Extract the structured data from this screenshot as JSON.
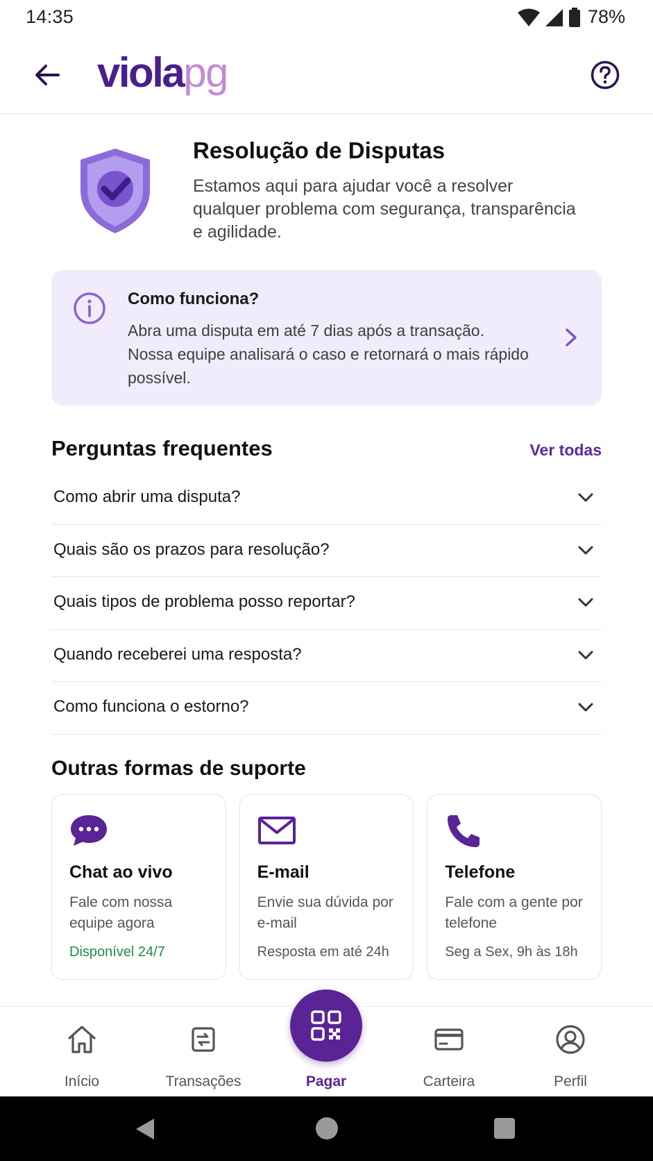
{
  "status_bar": {
    "time": "14:35",
    "battery": "78%"
  },
  "header": {
    "logo_part1": "viola",
    "logo_part2": "pg"
  },
  "hero": {
    "title": "Resolução de Disputas",
    "description": "Estamos aqui para ajudar você a resolver qualquer problema com segurança, transparência e agilidade."
  },
  "info_card": {
    "title": "Como funciona?",
    "text": "Abra uma disputa em até 7 dias após a transação. Nossa equipe analisará o caso e retornará o mais rápido possível."
  },
  "faq": {
    "title": "Perguntas frequentes",
    "see_all": "Ver todas",
    "items": [
      {
        "question": "Como abrir uma disputa?"
      },
      {
        "question": "Quais são os prazos para resolução?"
      },
      {
        "question": "Quais tipos de problema posso reportar?"
      },
      {
        "question": "Quando receberei uma resposta?"
      },
      {
        "question": "Como funciona o estorno?"
      }
    ]
  },
  "support": {
    "title": "Outras formas de suporte",
    "cards": [
      {
        "icon": "chat-bubble-icon",
        "title": "Chat ao vivo",
        "description": "Fale com nossa equipe agora",
        "footer": "Disponível 24/7"
      },
      {
        "icon": "envelope-icon",
        "title": "E-mail",
        "description": "Envie sua dúvida por e-mail",
        "footer": "Resposta em até 24h"
      },
      {
        "icon": "phone-icon",
        "title": "Telefone",
        "description": "Fale com a gente por telefone",
        "footer": "Seg a Sex, 9h às 18h"
      }
    ]
  },
  "bottom_nav": {
    "items": [
      {
        "label": "Início",
        "icon": "home-icon"
      },
      {
        "label": "Transações",
        "icon": "transactions-icon"
      },
      {
        "label": "Pagar",
        "icon": "qr-code-icon",
        "active": true
      },
      {
        "label": "Carteira",
        "icon": "card-icon"
      },
      {
        "label": "Perfil",
        "icon": "profile-icon"
      }
    ]
  },
  "colors": {
    "primary": "#5a2396",
    "accent_light": "#f1ecfb",
    "success": "#1f8a4c",
    "logo_secondary": "#c38bd6"
  }
}
